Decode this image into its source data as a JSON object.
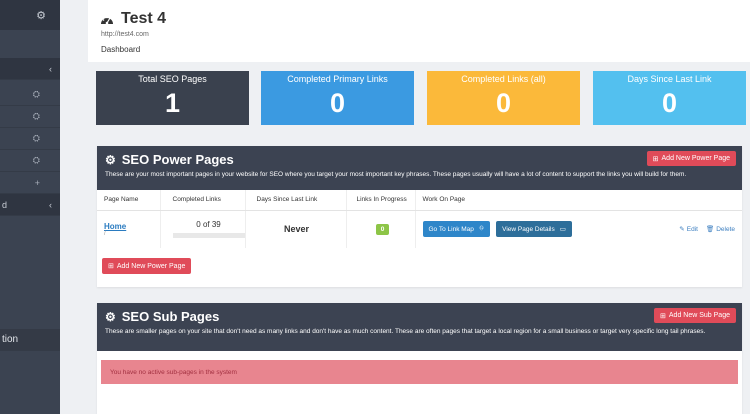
{
  "sidebar": {
    "rows": [
      {
        "name": "sidebar-item-1",
        "glyph": "⛭"
      },
      {
        "name": "sidebar-item-2",
        "glyph": "⛭"
      },
      {
        "name": "sidebar-item-3",
        "glyph": "⛭"
      },
      {
        "name": "sidebar-item-4",
        "glyph": "⛭"
      },
      {
        "name": "sidebar-item-5",
        "glyph": "+"
      }
    ],
    "section2_letter": "d",
    "bottom_label": "tion"
  },
  "header": {
    "title": "Test 4",
    "url": "http://test4.com",
    "breadcrumb": "Dashboard"
  },
  "stats": [
    {
      "label": "Total SEO Pages",
      "value": "1",
      "color": "#3a414e"
    },
    {
      "label": "Completed Primary Links",
      "value": "0",
      "color": "#3b9ae1"
    },
    {
      "label": "Completed Links (all)",
      "value": "0",
      "color": "#fbb93a"
    },
    {
      "label": "Days Since Last Link",
      "value": "0",
      "color": "#53c0ef"
    }
  ],
  "power": {
    "title": "SEO Power Pages",
    "description": "These are your most important pages in your website for SEO where you target your most important key phrases. These pages usually will have a lot of content to support the links you will build for them.",
    "add_label": "Add New Power Page",
    "columns": [
      "Page Name",
      "Completed Links",
      "Days Since Last Link",
      "Links In Progress",
      "Work On Page"
    ],
    "row": {
      "page_name": "Home",
      "page_path": "/",
      "completed": "0 of 39",
      "completed_fraction": 0,
      "days_since": "Never",
      "in_progress": "0",
      "go_label": "Go To Link Map",
      "view_label": "View Page Details",
      "edit_label": "Edit",
      "delete_label": "Delete"
    },
    "add_bottom_label": "Add New Power Page"
  },
  "sub": {
    "title": "SEO Sub Pages",
    "description": "These are smaller pages on your site that don't need as many links and don't have as much content. These are often pages that target a local region for a small business or target very specific long tail phrases.",
    "add_label": "Add New Sub Page",
    "empty_message": "You have no active sub-pages in the system"
  }
}
